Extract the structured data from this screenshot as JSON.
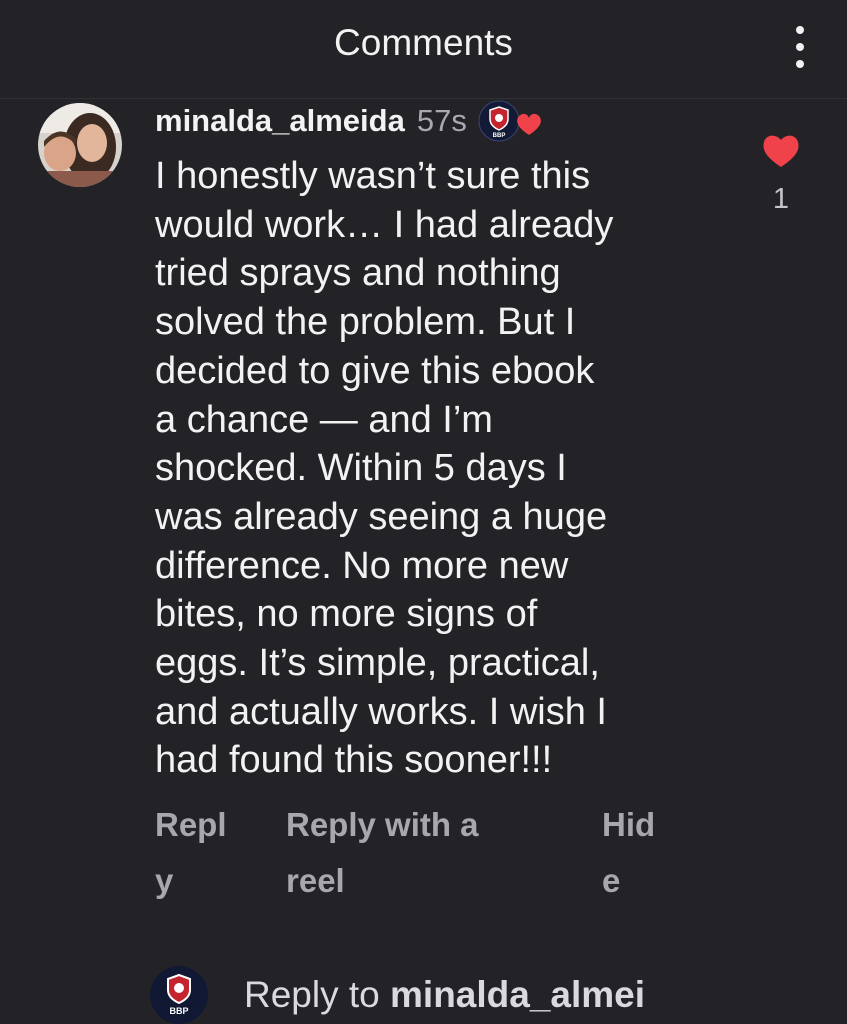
{
  "header": {
    "title": "Comments",
    "menu_icon": "more-vertical-icon"
  },
  "comment": {
    "username": "minalda_almeida",
    "time": "57s",
    "creator_badge_text": "BBP",
    "text": "I honestly wasn’t sure this\nwould work… I had already\ntried sprays and nothing\nsolved the problem. But I\ndecided to give this ebook\na chance — and I’m\nshocked. Within 5 days I\nwas already seeing a huge\ndifference. No more new\nbites, no more signs of\neggs. It’s simple, practical,\nand actually works. I wish I\nhad found this sooner!!!",
    "like_count": "1",
    "liked": true
  },
  "actions": {
    "reply": "Repl\ny",
    "reply_with_reel": "Reply with a\nreel",
    "hide": "Hid\ne"
  },
  "reply_bar": {
    "prefix": "Reply to ",
    "target": "minalda_almei",
    "avatar_text": "BBP"
  },
  "colors": {
    "background": "#232327",
    "like_red": "#f0424a",
    "muted_text": "#a7a7ad"
  }
}
